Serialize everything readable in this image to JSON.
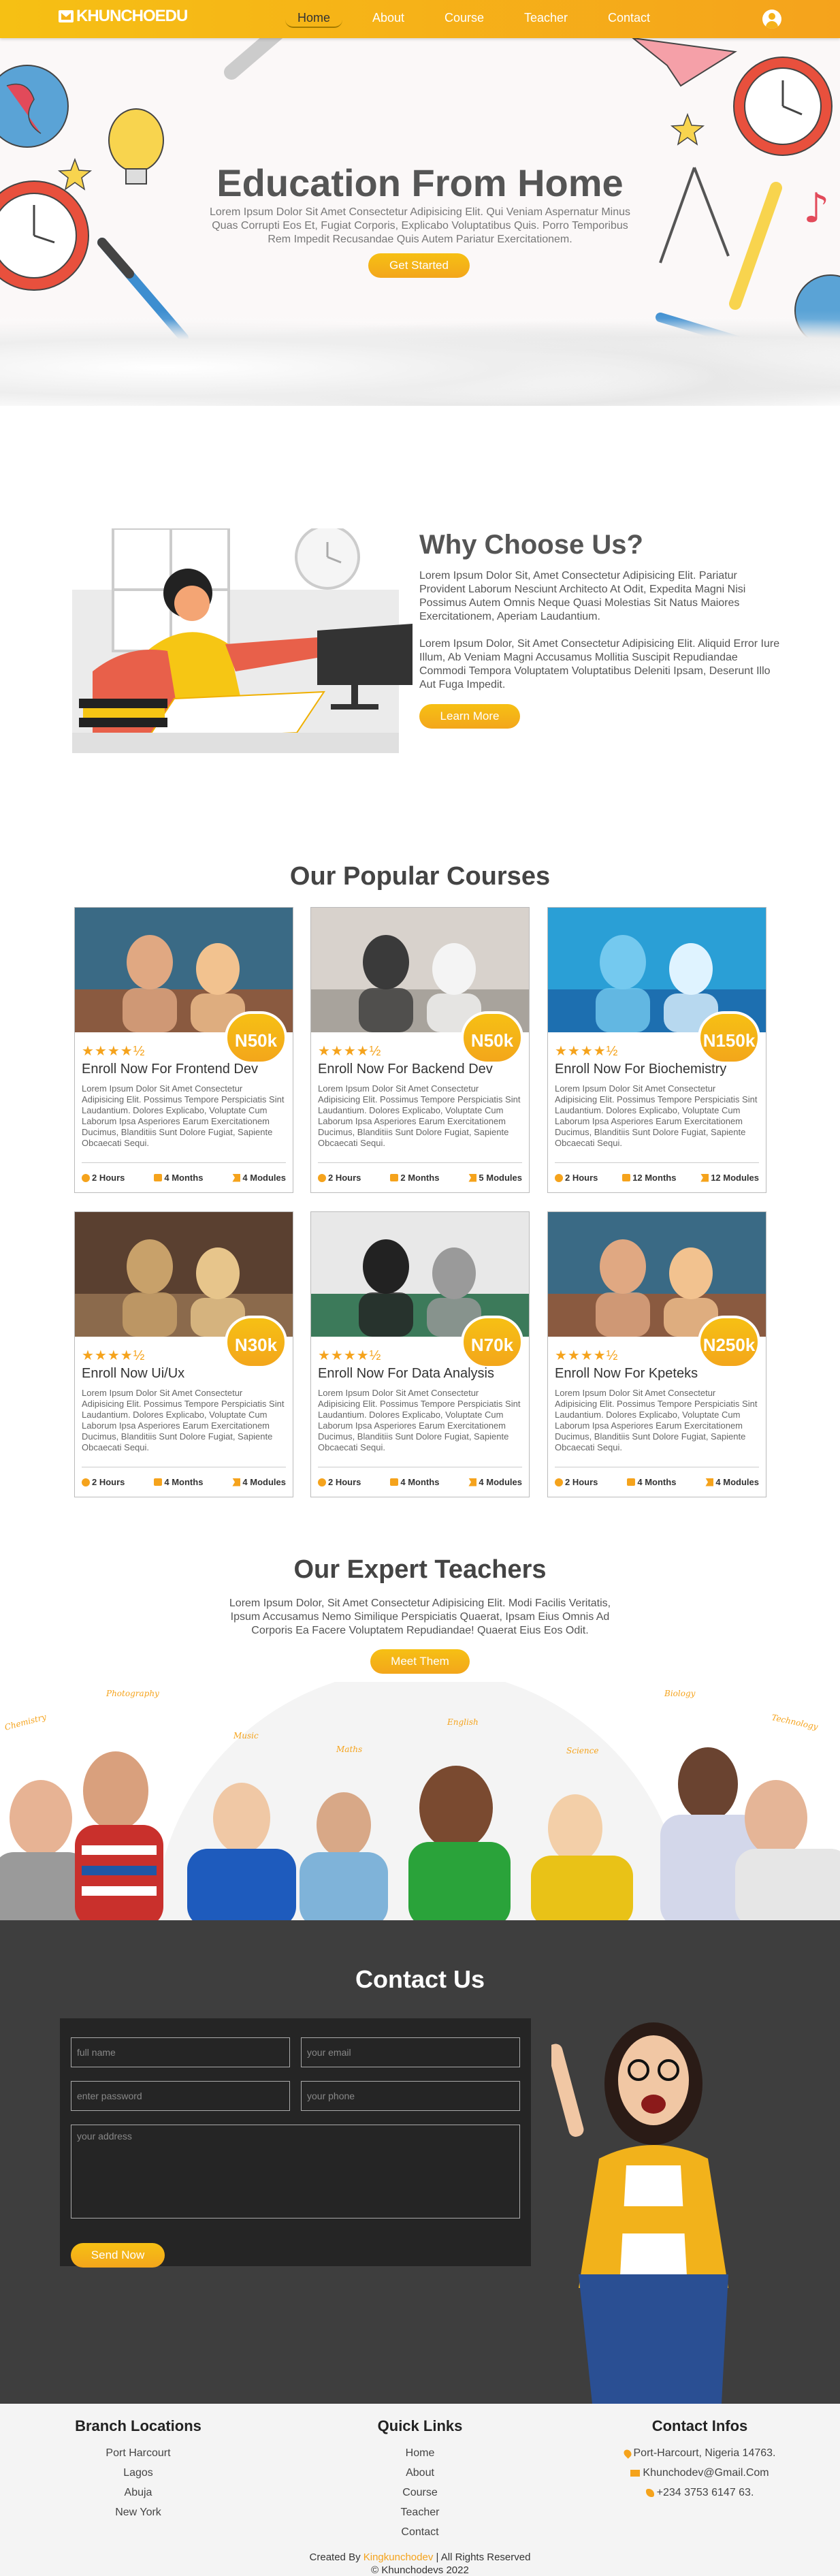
{
  "brand": {
    "name": "KHUNCHOEDU"
  },
  "nav": {
    "links": [
      "Home",
      "About",
      "Course",
      "Teacher",
      "Contact"
    ],
    "active": "Home"
  },
  "hero": {
    "title": "Education From Home",
    "text": "Lorem Ipsum Dolor Sit Amet Consectetur Adipisicing Elit. Qui Veniam Aspernatur Minus Quas Corrupti Eos Et, Fugiat Corporis, Explicabo Voluptatibus Quis. Porro Temporibus Rem Impedit Recusandae Quis Autem Pariatur Exercitationem.",
    "button": "Get Started"
  },
  "why": {
    "title": "Why Choose Us?",
    "p1": "Lorem Ipsum Dolor Sit, Amet Consectetur Adipisicing Elit. Pariatur Provident Laborum Nesciunt Architecto At Odit, Expedita Magni Nisi Possimus Autem Omnis Neque Quasi Molestias Sit Natus Maiores Exercitationem, Aperiam Laudantium.",
    "p2": "Lorem Ipsum Dolor, Sit Amet Consectetur Adipisicing Elit. Aliquid Error Iure Illum, Ab Veniam Magni Accusamus Mollitia Suscipit Repudiandae Commodi Tempora Voluptatem Voluptatibus Deleniti Ipsam, Deserunt Illo Aut Fuga Impedit.",
    "button": "Learn More"
  },
  "courses": {
    "title": "Our Popular Courses",
    "rating": "★★★★½",
    "desc": "Lorem Ipsum Dolor Sit Amet Consectetur Adipisicing Elit. Possimus Tempore Perspiciatis Sint Laudantium. Dolores Explicabo, Voluptate Cum Laborum Ipsa Asperiores Earum Exercitationem Ducimus, Blanditiis Sunt Dolore Fugiat, Sapiente Obcaecati Sequi.",
    "items": [
      {
        "title": "Enroll Now For Frontend Dev",
        "price": "N50k",
        "hours": "2 Hours",
        "months": "4 Months",
        "modules": "4 Modules"
      },
      {
        "title": "Enroll Now For Backend Dev",
        "price": "N50k",
        "hours": "2 Hours",
        "months": "2 Months",
        "modules": "5 Modules"
      },
      {
        "title": "Enroll Now For Biochemistry",
        "price": "N150k",
        "hours": "2 Hours",
        "months": "12 Months",
        "modules": "12 Modules"
      },
      {
        "title": "Enroll Now Ui/Ux",
        "price": "N30k",
        "hours": "2 Hours",
        "months": "4 Months",
        "modules": "4 Modules"
      },
      {
        "title": "Enroll Now For Data Analysis",
        "price": "N70k",
        "hours": "2 Hours",
        "months": "4 Months",
        "modules": "4 Modules"
      },
      {
        "title": "Enroll Now For Kpeteks",
        "price": "N250k",
        "hours": "2 Hours",
        "months": "4 Months",
        "modules": "4 Modules"
      }
    ]
  },
  "teachers": {
    "title": "Our Expert Teachers",
    "text": "Lorem Ipsum Dolor, Sit Amet Consectetur Adipisicing Elit. Modi Facilis Veritatis, Ipsum Accusamus Nemo Similique Perspiciatis Quaerat, Ipsam Eius Omnis Ad Corporis Ea Facere Voluptatem Repudiandae! Quaerat Eius Eos Odit.",
    "button": "Meet Them",
    "subjects": [
      "Chemistry",
      "Photography",
      "Music",
      "Maths",
      "English",
      "Science",
      "Biology",
      "Technology"
    ]
  },
  "contact": {
    "title": "Contact Us",
    "placeholders": {
      "name": "full name",
      "email": "your email",
      "password": "enter password",
      "phone": "your phone",
      "address": "your address"
    },
    "button": "Send Now"
  },
  "footer": {
    "branch_title": "Branch Locations",
    "branches": [
      "Port Harcourt",
      "Lagos",
      "Abuja",
      "New York"
    ],
    "links_title": "Quick Links",
    "links": [
      "Home",
      "About",
      "Course",
      "Teacher",
      "Contact"
    ],
    "info_title": "Contact Infos",
    "address": "Port-Harcourt, Nigeria 14763.",
    "email": "Khunchodev@Gmail.Com",
    "phone": "+234 3753 6147 63.",
    "credit_prefix": "Created By",
    "credit_brand": "Kingkunchodev",
    "credit_suffix": "| All Rights Reserved",
    "copyright": "© Khunchodevs 2022"
  },
  "colors": {
    "accent": "#f5a31c",
    "accent_light": "#f6c014",
    "dark": "#3e3e3e"
  }
}
